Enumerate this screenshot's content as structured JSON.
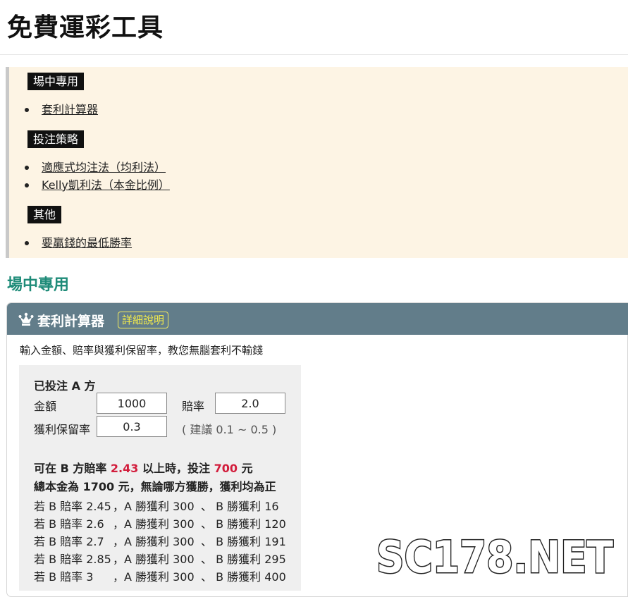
{
  "site": {
    "title": "免費運彩工具"
  },
  "toc": {
    "groups": [
      {
        "label": "場中專用",
        "items": [
          "套利計算器"
        ]
      },
      {
        "label": "投注策略",
        "items": [
          "適應式均注法（均利法）",
          "Kelly凱利法（本金比例）"
        ]
      },
      {
        "label": "其他",
        "items": [
          "要贏錢的最低勝率"
        ]
      }
    ]
  },
  "section": {
    "heading": "場中專用"
  },
  "card": {
    "title": "套利計算器",
    "detail_label": "詳細說明",
    "description": "輸入金額、賠率與獲利保留率，教您無腦套利不輸錢",
    "icon": "crown-icon"
  },
  "calc": {
    "placed_label": "已投注 A 方",
    "amount_label": "金額",
    "amount_value": "1000",
    "odds_label": "賠率",
    "odds_value": "2.0",
    "retain_label": "獲利保留率",
    "retain_value": "0.3",
    "suggestion": "( 建議 0.1 ~ 0.5 )",
    "result_prefix": "可在 B 方賠率",
    "result_odds": "2.43",
    "result_mid": "以上時，投注",
    "result_stake": "700",
    "result_suffix": "元",
    "total_line": "總本金為 1700 元，無論哪方獲勝，獲利均為正",
    "rows": [
      {
        "odds": "若 B 賠率 2.45",
        "a": "，A 勝獲利 300",
        "b": "、 B 勝獲利 16"
      },
      {
        "odds": "若 B 賠率 2.6",
        "a": "，A 勝獲利 300",
        "b": "、 B 勝獲利 120"
      },
      {
        "odds": "若 B 賠率 2.7",
        "a": "，A 勝獲利 300",
        "b": "、 B 勝獲利 191"
      },
      {
        "odds": "若 B 賠率 2.85",
        "a": "，A 勝獲利 300",
        "b": "、 B 勝獲利 295"
      },
      {
        "odds": "若 B 賠率 3",
        "a": "，A 勝獲利 300",
        "b": "、 B 勝獲利 400"
      }
    ]
  },
  "watermark": {
    "text": "SC178.NET"
  },
  "colors": {
    "header_bg": "#627d8a",
    "accent_green": "#1e8b78",
    "highlight_red": "#d21d3c",
    "toc_bg": "#fdf4e4"
  }
}
